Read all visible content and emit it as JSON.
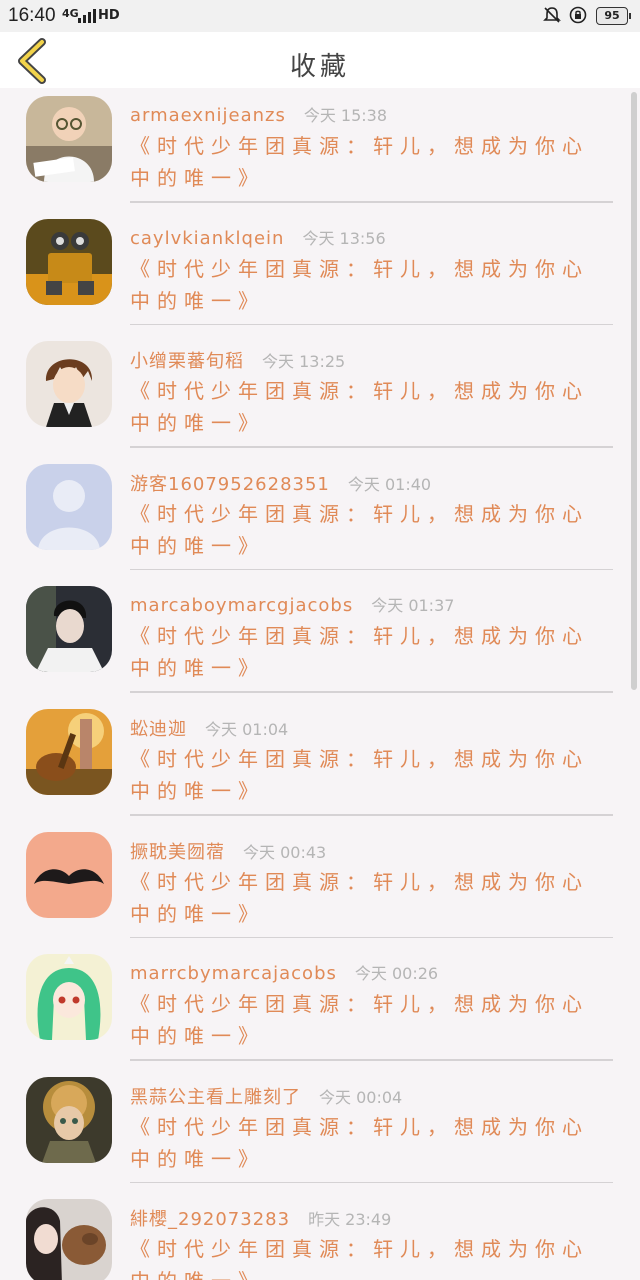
{
  "status_bar": {
    "time": "16:40",
    "network": "4G",
    "hd": "HD",
    "battery": "95"
  },
  "header": {
    "title": "收藏",
    "back_icon": "chevron-left-icon"
  },
  "favorites": [
    {
      "name": "armaexnijeanzs",
      "time": "今天 15:38",
      "content": "《时代少年团真源：轩儿，想成为你心中的唯一》",
      "avatar": "baby-reading"
    },
    {
      "name": "caylvkianklqein",
      "time": "今天 13:56",
      "content": "《时代少年团真源：轩儿，想成为你心中的唯一》",
      "avatar": "robot"
    },
    {
      "name": "小缯栗蕃旬稻",
      "time": "今天 13:25",
      "content": "《时代少年团真源：轩儿，想成为你心中的唯一》",
      "avatar": "anime-boy"
    },
    {
      "name": "游客1607952628351",
      "time": "今天 01:40",
      "content": "《时代少年团真源：轩儿，想成为你心中的唯一》",
      "avatar": "default-user"
    },
    {
      "name": "marcaboymarcgjacobs",
      "time": "今天 01:37",
      "content": "《时代少年团真源：轩儿，想成为你心中的唯一》",
      "avatar": "young-man"
    },
    {
      "name": "蚣迪迦",
      "time": "今天 01:04",
      "content": "《时代少年团真源：轩儿，想成为你心中的唯一》",
      "avatar": "guitar-sunset"
    },
    {
      "name": "撅耽美囫蓿",
      "time": "今天 00:43",
      "content": "《时代少年团真源：轩儿，想成为你心中的唯一》",
      "avatar": "mustache"
    },
    {
      "name": "marrcbymarcajacobs",
      "time": "今天 00:26",
      "content": "《时代少年团真源：轩儿，想成为你心中的唯一》",
      "avatar": "anime-girl-green"
    },
    {
      "name": "黑蒜公主看上雕刻了",
      "time": "今天 00:04",
      "content": "《时代少年团真源：轩儿，想成为你心中的唯一》",
      "avatar": "painted-girl"
    },
    {
      "name": "緋櫻_292073283",
      "time": "昨天 23:49",
      "content": "《时代少年团真源：轩儿，想成为你心中的唯一》",
      "avatar": "girl-with-dog"
    }
  ]
}
